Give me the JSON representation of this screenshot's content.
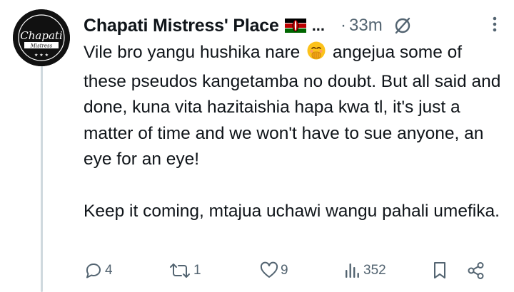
{
  "tweet": {
    "author_name": "Chapati Mistress' Place",
    "name_truncation": "...",
    "separator": "·",
    "time": "33m",
    "avatar_text": "Chapati",
    "avatar_subtext": "Mistress",
    "paragraph_1_before_emoji": "Vile bro yangu hushika nare",
    "paragraph_1_after_emoji": "angejua some of these pseudos kangetamba no doubt. But all said and done, kuna vita hazitaishia hapa kwa tl, it's just a matter of time and we won't have to sue anyone, an eye for an eye!",
    "paragraph_2": "Keep it coming, mtajua uchawi wangu pahali umefika."
  },
  "actions": {
    "replies": "4",
    "reposts": "1",
    "likes": "9",
    "views": "352"
  },
  "icons": {
    "flag": "kenya-flag-icon",
    "emoji": "hand-over-mouth-emoji-icon",
    "grok": "grok-icon",
    "more": "more-dots-icon",
    "reply": "reply-icon",
    "repost": "repost-icon",
    "like": "heart-icon",
    "views": "views-chart-icon",
    "bookmark": "bookmark-icon",
    "share": "share-icon"
  },
  "colors": {
    "text": "#0f1419",
    "secondary": "#536471",
    "thread_line": "#cfd9de",
    "background": "#ffffff"
  }
}
